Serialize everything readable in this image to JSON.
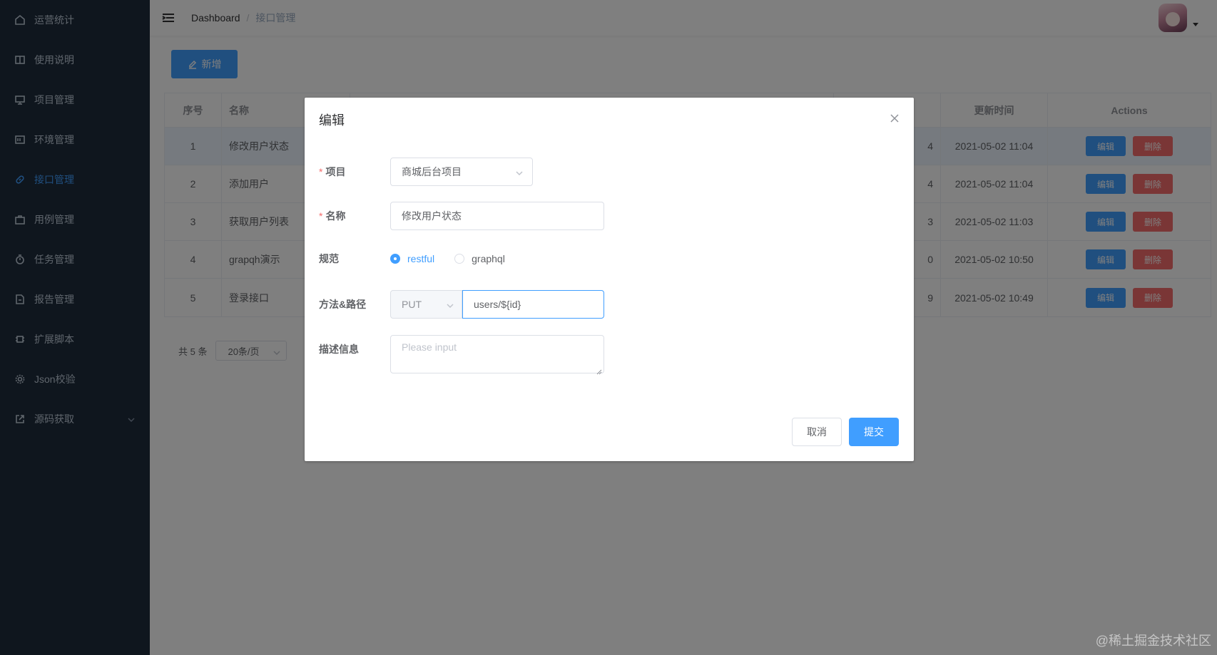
{
  "sidebar": {
    "items": [
      {
        "label": "运营统计",
        "icon": "home-icon"
      },
      {
        "label": "使用说明",
        "icon": "book-icon"
      },
      {
        "label": "项目管理",
        "icon": "monitor-icon"
      },
      {
        "label": "环境管理",
        "icon": "server-icon"
      },
      {
        "label": "接口管理",
        "icon": "link-icon",
        "active": true
      },
      {
        "label": "用例管理",
        "icon": "briefcase-icon"
      },
      {
        "label": "任务管理",
        "icon": "timer-icon"
      },
      {
        "label": "报告管理",
        "icon": "document-icon"
      },
      {
        "label": "扩展脚本",
        "icon": "chip-icon"
      },
      {
        "label": "Json校验",
        "icon": "gear-icon"
      },
      {
        "label": "源码获取",
        "icon": "external-link-icon"
      }
    ]
  },
  "header": {
    "breadcrumb_home": "Dashboard",
    "breadcrumb_sep": "/",
    "breadcrumb_current": "接口管理"
  },
  "toolbar": {
    "add_label": "新增"
  },
  "table": {
    "headers": {
      "index": "序号",
      "name": "名称",
      "updated": "更新时间",
      "actions": "Actions"
    },
    "rows": [
      {
        "index": "1",
        "name": "修改用户状态",
        "partial": "4",
        "updated": "2021-05-02 11:04"
      },
      {
        "index": "2",
        "name": "添加用户",
        "partial": "4",
        "updated": "2021-05-02 11:04"
      },
      {
        "index": "3",
        "name": "获取用户列表",
        "partial": "3",
        "updated": "2021-05-02 11:03"
      },
      {
        "index": "4",
        "name": "grapqh演示",
        "partial": "0",
        "updated": "2021-05-02 10:50"
      },
      {
        "index": "5",
        "name": "登录接口",
        "partial": "9",
        "updated": "2021-05-02 10:49"
      }
    ],
    "edit_label": "编辑",
    "delete_label": "删除"
  },
  "pager": {
    "total": "共 5 条",
    "page_size": "20条/页"
  },
  "dialog": {
    "title": "编辑",
    "project_label": "项目",
    "project_value": "商城后台项目",
    "name_label": "名称",
    "name_value": "修改用户状态",
    "spec_label": "规范",
    "spec_options": [
      "restful",
      "graphql"
    ],
    "spec_selected": "restful",
    "method_label": "方法&路径",
    "method_value": "PUT",
    "path_value": "users/${id}",
    "desc_label": "描述信息",
    "desc_placeholder": "Please input",
    "cancel_label": "取消",
    "submit_label": "提交"
  },
  "watermark": "@稀土掘金技术社区",
  "colors": {
    "primary": "#409eff",
    "danger": "#f56c6c",
    "sidebar_bg": "#1f2d3d"
  }
}
